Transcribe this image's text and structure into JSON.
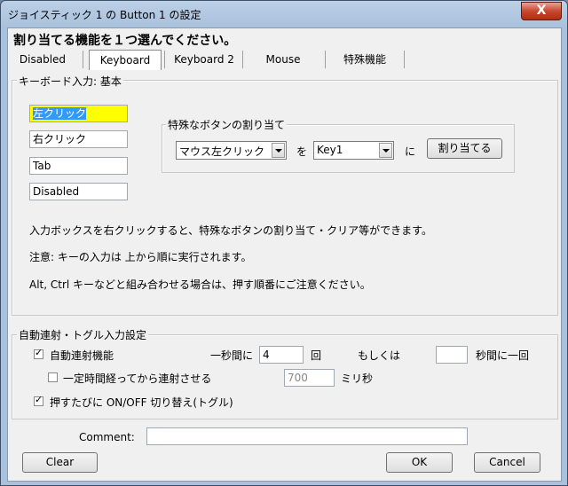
{
  "window": {
    "title": "ジョイスティック 1 の Button 1 の設定",
    "close_label": "X"
  },
  "heading": "割り当てる機能を１つ選んでください。",
  "tabs": [
    {
      "label": "Disabled"
    },
    {
      "label": "Keyboard",
      "active": true
    },
    {
      "label": "Keyboard 2"
    },
    {
      "label": "Mouse"
    },
    {
      "label": "特殊機能"
    }
  ],
  "keyboard_group": {
    "title": "キーボード入力: 基本",
    "inputs": [
      "左クリック",
      "右クリック",
      "Tab",
      "Disabled"
    ],
    "special": {
      "title": "特殊なボタンの割り当て",
      "button_select": "マウス左クリック",
      "wo_label": "を",
      "key_select": "Key1",
      "ni_label": "に",
      "assign_label": "割り当てる"
    },
    "notes": [
      "入力ボックスを右クリックすると、特殊なボタンの割り当て・クリア等ができます。",
      "注意: キーの入力は 上から順に実行されます。",
      "Alt, Ctrl キーなどと組み合わせる場合は、押す順番にご注意ください。"
    ]
  },
  "auto_group": {
    "title": "自動連射・トグル入力設定",
    "autofire_label": "自動連射機能",
    "autofire_checked": true,
    "per_second_label": "一秒間に",
    "per_second_value": "4",
    "times_label": "回",
    "or_label": "もしくは",
    "seconds_value": "",
    "seconds_label": "秒間に一回",
    "delay_label": "一定時間経ってから連射させる",
    "delay_checked": false,
    "delay_value": "700",
    "ms_label": "ミリ秒",
    "toggle_label": "押すたびに ON/OFF 切り替え(トグル)",
    "toggle_checked": true
  },
  "comment": {
    "label": "Comment:",
    "value": ""
  },
  "buttons": {
    "clear": "Clear",
    "ok": "OK",
    "cancel": "Cancel"
  }
}
